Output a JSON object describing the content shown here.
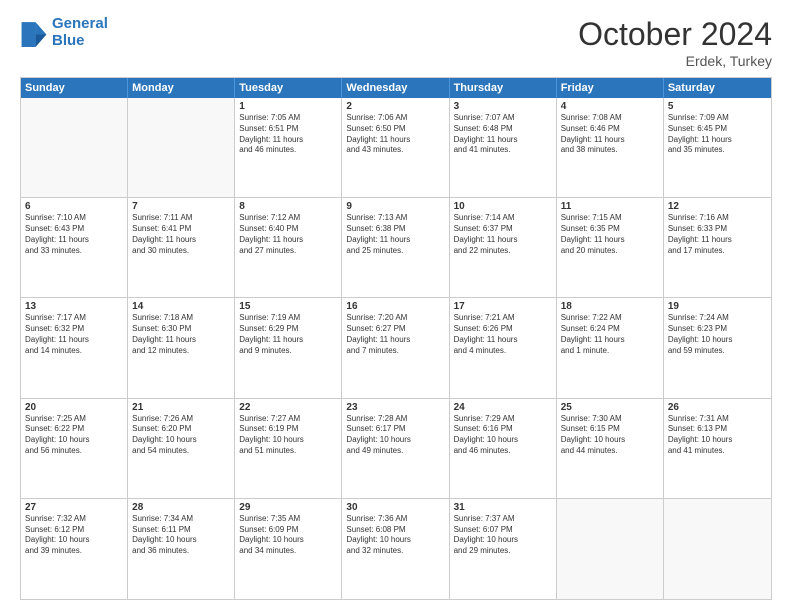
{
  "header": {
    "logo_general": "General",
    "logo_blue": "Blue",
    "month_title": "October 2024",
    "location": "Erdek, Turkey"
  },
  "weekdays": [
    "Sunday",
    "Monday",
    "Tuesday",
    "Wednesday",
    "Thursday",
    "Friday",
    "Saturday"
  ],
  "rows": [
    [
      {
        "day": "",
        "empty": true
      },
      {
        "day": "",
        "empty": true
      },
      {
        "day": "1",
        "lines": [
          "Sunrise: 7:05 AM",
          "Sunset: 6:51 PM",
          "Daylight: 11 hours",
          "and 46 minutes."
        ]
      },
      {
        "day": "2",
        "lines": [
          "Sunrise: 7:06 AM",
          "Sunset: 6:50 PM",
          "Daylight: 11 hours",
          "and 43 minutes."
        ]
      },
      {
        "day": "3",
        "lines": [
          "Sunrise: 7:07 AM",
          "Sunset: 6:48 PM",
          "Daylight: 11 hours",
          "and 41 minutes."
        ]
      },
      {
        "day": "4",
        "lines": [
          "Sunrise: 7:08 AM",
          "Sunset: 6:46 PM",
          "Daylight: 11 hours",
          "and 38 minutes."
        ]
      },
      {
        "day": "5",
        "lines": [
          "Sunrise: 7:09 AM",
          "Sunset: 6:45 PM",
          "Daylight: 11 hours",
          "and 35 minutes."
        ]
      }
    ],
    [
      {
        "day": "6",
        "lines": [
          "Sunrise: 7:10 AM",
          "Sunset: 6:43 PM",
          "Daylight: 11 hours",
          "and 33 minutes."
        ]
      },
      {
        "day": "7",
        "lines": [
          "Sunrise: 7:11 AM",
          "Sunset: 6:41 PM",
          "Daylight: 11 hours",
          "and 30 minutes."
        ]
      },
      {
        "day": "8",
        "lines": [
          "Sunrise: 7:12 AM",
          "Sunset: 6:40 PM",
          "Daylight: 11 hours",
          "and 27 minutes."
        ]
      },
      {
        "day": "9",
        "lines": [
          "Sunrise: 7:13 AM",
          "Sunset: 6:38 PM",
          "Daylight: 11 hours",
          "and 25 minutes."
        ]
      },
      {
        "day": "10",
        "lines": [
          "Sunrise: 7:14 AM",
          "Sunset: 6:37 PM",
          "Daylight: 11 hours",
          "and 22 minutes."
        ]
      },
      {
        "day": "11",
        "lines": [
          "Sunrise: 7:15 AM",
          "Sunset: 6:35 PM",
          "Daylight: 11 hours",
          "and 20 minutes."
        ]
      },
      {
        "day": "12",
        "lines": [
          "Sunrise: 7:16 AM",
          "Sunset: 6:33 PM",
          "Daylight: 11 hours",
          "and 17 minutes."
        ]
      }
    ],
    [
      {
        "day": "13",
        "lines": [
          "Sunrise: 7:17 AM",
          "Sunset: 6:32 PM",
          "Daylight: 11 hours",
          "and 14 minutes."
        ]
      },
      {
        "day": "14",
        "lines": [
          "Sunrise: 7:18 AM",
          "Sunset: 6:30 PM",
          "Daylight: 11 hours",
          "and 12 minutes."
        ]
      },
      {
        "day": "15",
        "lines": [
          "Sunrise: 7:19 AM",
          "Sunset: 6:29 PM",
          "Daylight: 11 hours",
          "and 9 minutes."
        ]
      },
      {
        "day": "16",
        "lines": [
          "Sunrise: 7:20 AM",
          "Sunset: 6:27 PM",
          "Daylight: 11 hours",
          "and 7 minutes."
        ]
      },
      {
        "day": "17",
        "lines": [
          "Sunrise: 7:21 AM",
          "Sunset: 6:26 PM",
          "Daylight: 11 hours",
          "and 4 minutes."
        ]
      },
      {
        "day": "18",
        "lines": [
          "Sunrise: 7:22 AM",
          "Sunset: 6:24 PM",
          "Daylight: 11 hours",
          "and 1 minute."
        ]
      },
      {
        "day": "19",
        "lines": [
          "Sunrise: 7:24 AM",
          "Sunset: 6:23 PM",
          "Daylight: 10 hours",
          "and 59 minutes."
        ]
      }
    ],
    [
      {
        "day": "20",
        "lines": [
          "Sunrise: 7:25 AM",
          "Sunset: 6:22 PM",
          "Daylight: 10 hours",
          "and 56 minutes."
        ]
      },
      {
        "day": "21",
        "lines": [
          "Sunrise: 7:26 AM",
          "Sunset: 6:20 PM",
          "Daylight: 10 hours",
          "and 54 minutes."
        ]
      },
      {
        "day": "22",
        "lines": [
          "Sunrise: 7:27 AM",
          "Sunset: 6:19 PM",
          "Daylight: 10 hours",
          "and 51 minutes."
        ]
      },
      {
        "day": "23",
        "lines": [
          "Sunrise: 7:28 AM",
          "Sunset: 6:17 PM",
          "Daylight: 10 hours",
          "and 49 minutes."
        ]
      },
      {
        "day": "24",
        "lines": [
          "Sunrise: 7:29 AM",
          "Sunset: 6:16 PM",
          "Daylight: 10 hours",
          "and 46 minutes."
        ]
      },
      {
        "day": "25",
        "lines": [
          "Sunrise: 7:30 AM",
          "Sunset: 6:15 PM",
          "Daylight: 10 hours",
          "and 44 minutes."
        ]
      },
      {
        "day": "26",
        "lines": [
          "Sunrise: 7:31 AM",
          "Sunset: 6:13 PM",
          "Daylight: 10 hours",
          "and 41 minutes."
        ]
      }
    ],
    [
      {
        "day": "27",
        "lines": [
          "Sunrise: 7:32 AM",
          "Sunset: 6:12 PM",
          "Daylight: 10 hours",
          "and 39 minutes."
        ]
      },
      {
        "day": "28",
        "lines": [
          "Sunrise: 7:34 AM",
          "Sunset: 6:11 PM",
          "Daylight: 10 hours",
          "and 36 minutes."
        ]
      },
      {
        "day": "29",
        "lines": [
          "Sunrise: 7:35 AM",
          "Sunset: 6:09 PM",
          "Daylight: 10 hours",
          "and 34 minutes."
        ]
      },
      {
        "day": "30",
        "lines": [
          "Sunrise: 7:36 AM",
          "Sunset: 6:08 PM",
          "Daylight: 10 hours",
          "and 32 minutes."
        ]
      },
      {
        "day": "31",
        "lines": [
          "Sunrise: 7:37 AM",
          "Sunset: 6:07 PM",
          "Daylight: 10 hours",
          "and 29 minutes."
        ]
      },
      {
        "day": "",
        "empty": true
      },
      {
        "day": "",
        "empty": true
      }
    ]
  ]
}
